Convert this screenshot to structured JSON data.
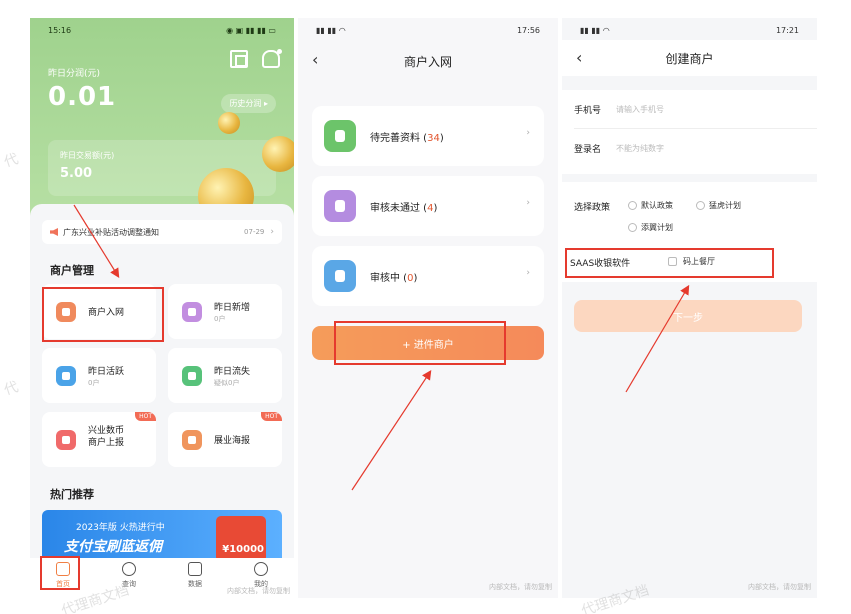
{
  "screen1": {
    "time": "15:16",
    "yesterday_share_label": "昨日分润(元)",
    "yesterday_share_value": "0.01",
    "history_button": "历史分润 ▸",
    "trade_label": "昨日交易额(元)",
    "trade_value": "5.00",
    "notice_text": "广东兴业补贴活动调整通知",
    "notice_date": "07-29",
    "section_merchant": "商户管理",
    "tiles": [
      {
        "title": "商户入网",
        "sub": "",
        "color": "#f08a5d"
      },
      {
        "title": "昨日新增",
        "sub": "0户",
        "color": "#c28ee0"
      },
      {
        "title": "昨日活跃",
        "sub": "0户",
        "color": "#4aa3e8"
      },
      {
        "title": "昨日流失",
        "sub": "疑似0户",
        "color": "#57c27a"
      },
      {
        "title": "兴业数币",
        "title2": "商户上报",
        "color": "#f06a6a",
        "badge": "HOT"
      },
      {
        "title": "展业海报",
        "sub": "",
        "color": "#f0955d",
        "badge": "HOT"
      }
    ],
    "section_hot": "热门推荐",
    "banner_line1": "2023年版 火热进行中",
    "banner_line2": "支付宝刷蓝返佣",
    "banner_amount": "¥10000",
    "tabs": [
      "首页",
      "查询",
      "数据",
      "我的"
    ],
    "footer_watermark": "内部文档，请勿复制"
  },
  "screen2": {
    "time": "17:56",
    "title": "商户入网",
    "rows": [
      {
        "label": "待完善资料",
        "count": "34",
        "color": "#6cc46a"
      },
      {
        "label": "审核未通过",
        "count": "4",
        "color": "#b48ce0"
      },
      {
        "label": "审核中",
        "count": "0",
        "color": "#5aa7e6"
      }
    ],
    "submit_button": "+ 进件商户",
    "footer_watermark": "内部文档，请勿复制"
  },
  "screen3": {
    "time": "17:21",
    "title": "创建商户",
    "phone_label": "手机号",
    "phone_placeholder": "请输入手机号",
    "login_label": "登录名",
    "login_placeholder": "不能为纯数字",
    "policy_label": "选择政策",
    "policies": [
      "默认政策",
      "猛虎计划",
      "添翼计划"
    ],
    "saas_label": "SAAS收银软件",
    "saas_option": "码上餐厅",
    "next_button": "下一步",
    "footer_watermark": "内部文档，请勿复制"
  },
  "watermarks": [
    "代",
    "代",
    "代理商文档",
    "代理商文档"
  ]
}
